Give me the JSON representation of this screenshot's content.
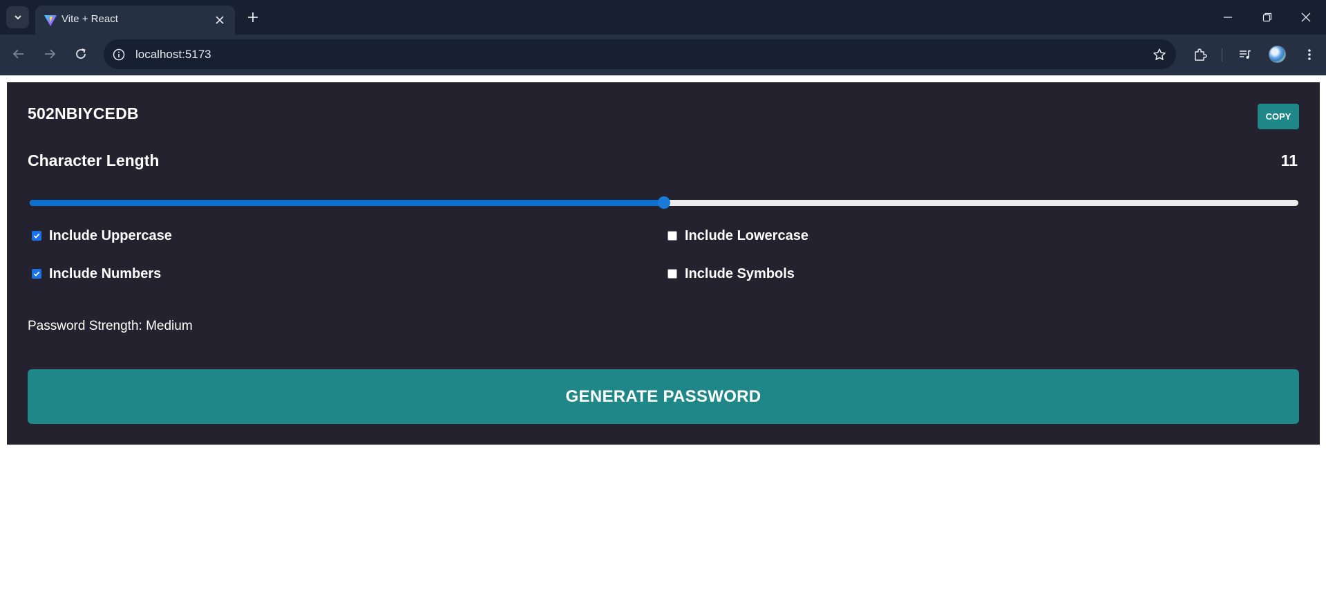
{
  "browser": {
    "tab_title": "Vite + React",
    "url": "localhost:5173",
    "icons": [
      "tab-search-icon",
      "vite-favicon",
      "close-icon",
      "plus-icon",
      "minimize-icon",
      "restore-icon",
      "close-window-icon",
      "back-icon",
      "forward-icon",
      "reload-icon",
      "site-info-icon",
      "star-icon",
      "extensions-icon",
      "media-control-icon",
      "profile-avatar",
      "more-menu-icon"
    ]
  },
  "app": {
    "password": "502NBIYCEDB",
    "copy_label": "COPY",
    "length_label": "Character Length",
    "length_value": "11",
    "slider": {
      "min": 6,
      "max": 16,
      "value": 11,
      "fill_color": "#0f6fcc",
      "track_color": "#ececec"
    },
    "options": [
      {
        "label": "Include Uppercase",
        "checked": true
      },
      {
        "label": "Include Lowercase",
        "checked": false
      },
      {
        "label": "Include Numbers",
        "checked": true
      },
      {
        "label": "Include Symbols",
        "checked": false
      }
    ],
    "strength_text": "Password Strength: Medium",
    "generate_label": "GENERATE PASSWORD"
  },
  "colors": {
    "panel_bg": "#24222e",
    "accent_teal": "#1f8788",
    "chrome_dark": "#172030",
    "chrome_mid": "#253142"
  }
}
